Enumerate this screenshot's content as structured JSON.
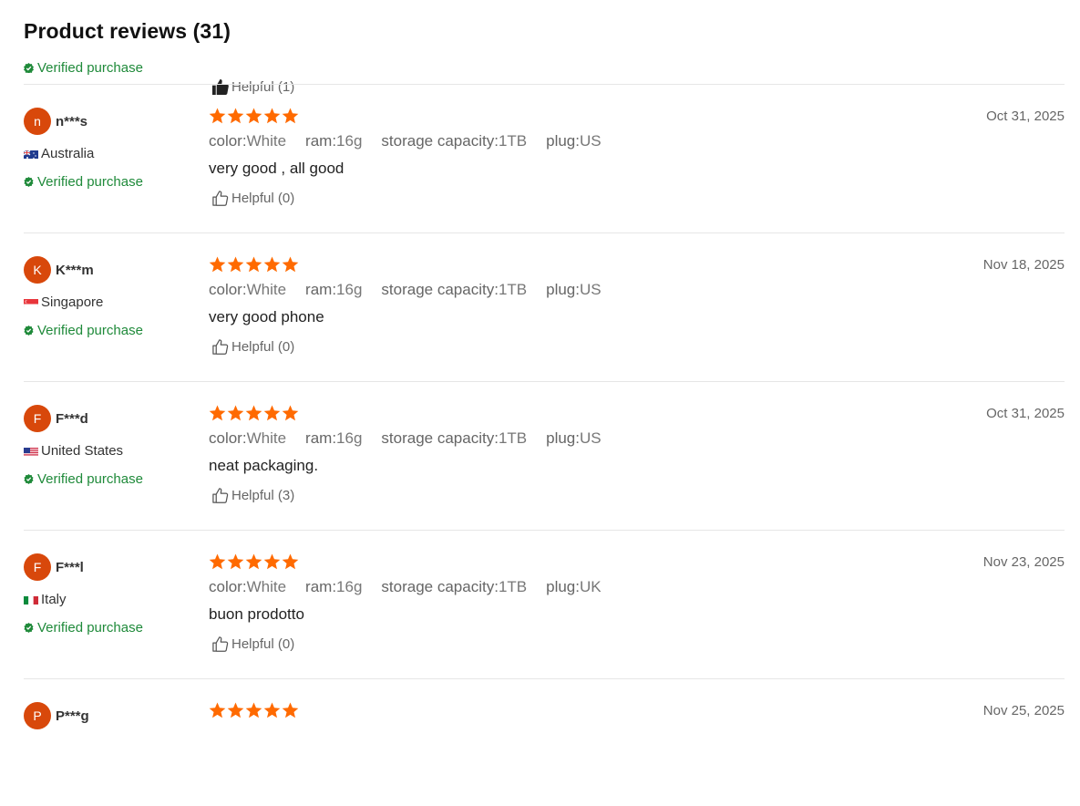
{
  "header": {
    "title": "Product reviews (31)"
  },
  "partial_top": {
    "verified_label": "Verified purchase",
    "helpful_label": "Helpful (1)"
  },
  "reviews": [
    {
      "initial": "n",
      "name": "n***s",
      "country": "Australia",
      "flag": "AU",
      "verified_label": "Verified purchase",
      "rating": 5,
      "attributes": [
        {
          "key": "color:",
          "value": "White"
        },
        {
          "key": "ram:",
          "value": "16g"
        },
        {
          "key": "storage capacity:",
          "value": "1TB"
        },
        {
          "key": "plug:",
          "value": "US"
        }
      ],
      "text": "very good , all good",
      "helpful_label": "Helpful (0)",
      "date": "Oct 31, 2025"
    },
    {
      "initial": "K",
      "name": "K***m",
      "country": "Singapore",
      "flag": "SG",
      "verified_label": "Verified purchase",
      "rating": 5,
      "attributes": [
        {
          "key": "color:",
          "value": "White"
        },
        {
          "key": "ram:",
          "value": "16g"
        },
        {
          "key": "storage capacity:",
          "value": "1TB"
        },
        {
          "key": "plug:",
          "value": "US"
        }
      ],
      "text": "very good phone",
      "helpful_label": "Helpful (0)",
      "date": "Nov 18, 2025"
    },
    {
      "initial": "F",
      "name": "F***d",
      "country": "United States",
      "flag": "US",
      "verified_label": "Verified purchase",
      "rating": 5,
      "attributes": [
        {
          "key": "color:",
          "value": "White"
        },
        {
          "key": "ram:",
          "value": "16g"
        },
        {
          "key": "storage capacity:",
          "value": "1TB"
        },
        {
          "key": "plug:",
          "value": "US"
        }
      ],
      "text": "neat packaging.",
      "helpful_label": "Helpful (3)",
      "date": "Oct 31, 2025"
    },
    {
      "initial": "F",
      "name": "F***l",
      "country": "Italy",
      "flag": "IT",
      "verified_label": "Verified purchase",
      "rating": 5,
      "attributes": [
        {
          "key": "color:",
          "value": "White"
        },
        {
          "key": "ram:",
          "value": "16g"
        },
        {
          "key": "storage capacity:",
          "value": "1TB"
        },
        {
          "key": "plug:",
          "value": "UK"
        }
      ],
      "text": "buon prodotto",
      "helpful_label": "Helpful (0)",
      "date": "Nov 23, 2025"
    },
    {
      "initial": "P",
      "name": "P***g",
      "rating": 5,
      "date": "Nov 25, 2025"
    }
  ],
  "colors": {
    "star": "#ff6a00",
    "avatar": "#d8480b",
    "verified": "#1f8a3a",
    "divider": "#e6e6e6"
  },
  "icons": {
    "helpful": "thumbs-up-icon",
    "verified": "verified-badge-icon",
    "star": "star-icon"
  }
}
